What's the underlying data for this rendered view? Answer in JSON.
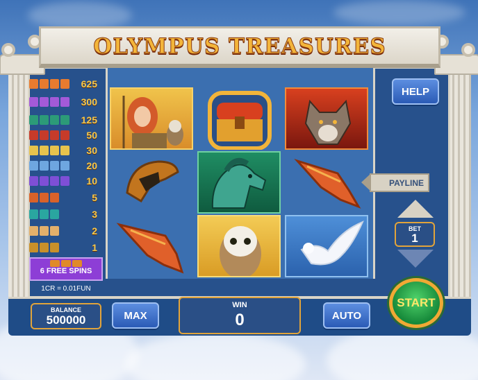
{
  "game": {
    "title": "OLYMPUS TREASURES"
  },
  "paytable": {
    "rows": [
      {
        "value": "625",
        "icon": "goddess",
        "color": "#e87b2f"
      },
      {
        "value": "300",
        "icon": "eagle",
        "color": "#a35ad8"
      },
      {
        "value": "125",
        "icon": "horse",
        "color": "#2c9b78"
      },
      {
        "value": "50",
        "icon": "wolf",
        "color": "#c63b2a"
      },
      {
        "value": "30",
        "icon": "owl",
        "color": "#e6c34d"
      },
      {
        "value": "20",
        "icon": "dove",
        "color": "#6ea6e0"
      },
      {
        "value": "10",
        "icon": "lightning",
        "color": "#7e4fd6"
      },
      {
        "value": "5",
        "icon": "spearhead",
        "color": "#d9622a"
      },
      {
        "value": "3",
        "icon": "gem",
        "color": "#2aa6a0"
      },
      {
        "value": "2",
        "icon": "quill",
        "color": "#e3b06b"
      },
      {
        "value": "1",
        "icon": "helmet",
        "color": "#c8902a"
      }
    ],
    "free_spins_label": "6 FREE SPINS",
    "credit_rate": "1CR = 0.01FUN"
  },
  "reels": [
    [
      {
        "symbol": "goddess-icon"
      },
      {
        "symbol": "helmet-icon"
      },
      {
        "symbol": "spearhead-icon"
      }
    ],
    [
      {
        "symbol": "treasure-chest-icon"
      },
      {
        "symbol": "horse-icon"
      },
      {
        "symbol": "owl-icon"
      }
    ],
    [
      {
        "symbol": "wolf-icon"
      },
      {
        "symbol": "spearhead-icon"
      },
      {
        "symbol": "dove-icon"
      }
    ]
  ],
  "controls": {
    "help_label": "HELP",
    "payline_label": "PAYLINE",
    "bet_label": "BET",
    "bet_value": "1",
    "balance_label": "BALANCE",
    "balance_value": "500000",
    "max_label": "MAX",
    "win_label": "WIN",
    "win_value": "0",
    "auto_label": "AUTO",
    "start_label": "START"
  }
}
